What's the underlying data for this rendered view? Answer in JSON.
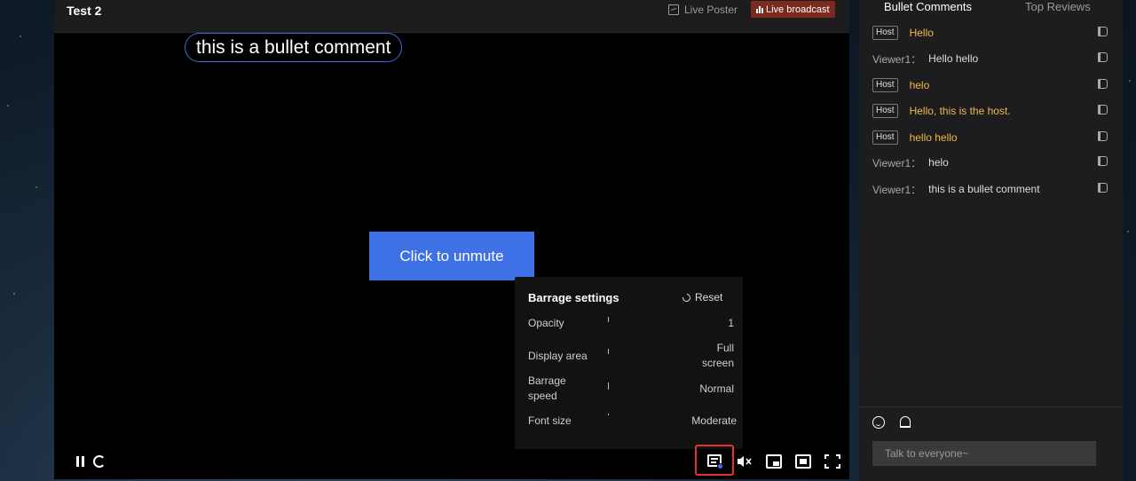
{
  "player": {
    "title": "Test 2",
    "live_poster_label": "Live Poster",
    "live_broadcast_label": "Live broadcast",
    "bullet_comment": "this is a bullet comment",
    "unmute_label": "Click to unmute"
  },
  "barrage_settings": {
    "title": "Barrage settings",
    "reset_label": "Reset",
    "rows": [
      {
        "label": "Opacity",
        "value": "1"
      },
      {
        "label": "Display area",
        "value": "Full screen"
      },
      {
        "label": "Barrage speed",
        "value": "Normal"
      },
      {
        "label": "Font size",
        "value": "Moderate"
      }
    ]
  },
  "chat": {
    "tabs": [
      "Bullet Comments",
      "Top Reviews"
    ],
    "host_tag": "Host",
    "messages": [
      {
        "role": "host",
        "user": "",
        "text": "Hello"
      },
      {
        "role": "viewer",
        "user": "Viewer1：",
        "text": "Hello hello"
      },
      {
        "role": "host",
        "user": "",
        "text": "helo"
      },
      {
        "role": "host",
        "user": "",
        "text": "Hello, this is the host."
      },
      {
        "role": "host",
        "user": "",
        "text": "hello hello"
      },
      {
        "role": "viewer",
        "user": "Viewer1：",
        "text": "helo"
      },
      {
        "role": "viewer",
        "user": "Viewer1：",
        "text": "this is a bullet comment"
      }
    ],
    "input_placeholder": "Talk to everyone~"
  },
  "colors": {
    "accent": "#3f71e6",
    "host": "#f0b94a",
    "live": "#7a2a1f",
    "highlight": "#e5312c"
  }
}
